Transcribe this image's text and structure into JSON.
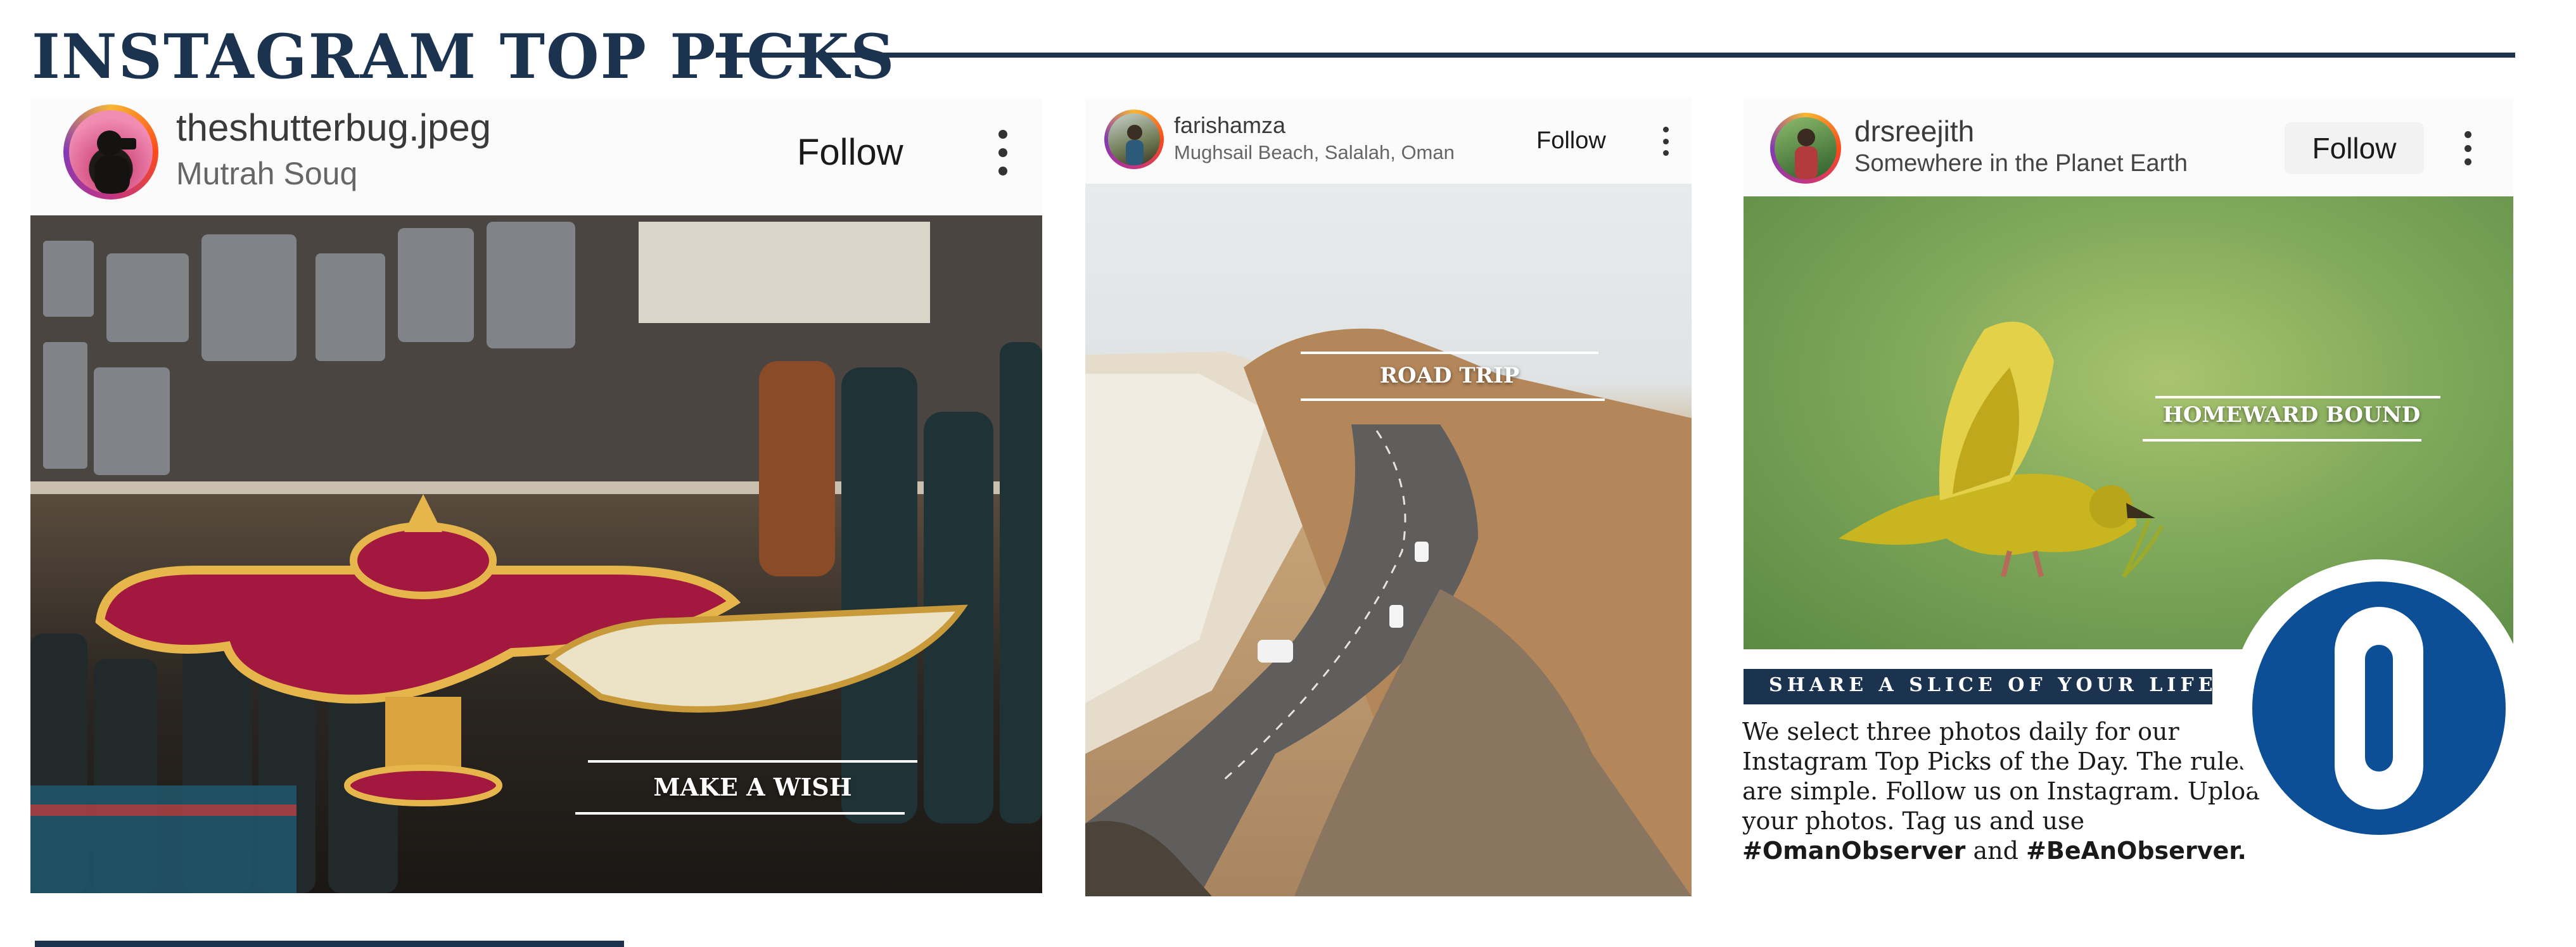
{
  "section": {
    "title": "INSTAGRAM TOP PICKS"
  },
  "posts": [
    {
      "username": "theshutterbug.jpeg",
      "location": "Mutrah Souq",
      "follow_label": "Follow",
      "caption": "MAKE A WISH"
    },
    {
      "username": "farishamza",
      "location": "Mughsail Beach, Salalah, Oman",
      "follow_label": "Follow",
      "caption": "ROAD TRIP"
    },
    {
      "username": "drsreejith",
      "location": "Somewhere in the Planet Earth",
      "follow_label": "Follow",
      "caption": "HOMEWARD BOUND"
    }
  ],
  "share": {
    "banner": "SHARE A SLICE OF YOUR LIFE",
    "body": "We select three photos daily for our Instagram Top Picks of the Day. The rules are simple. Follow us on Instagram. Upload your photos. Tag us and use",
    "hashtag1": "#OmanObserver",
    "conjunction": "and",
    "hashtag2": "#BeAnObserver."
  },
  "logo": {
    "letter": "O"
  },
  "icons": {
    "menu": "more-vertical-icon",
    "avatar": "profile-avatar-icon"
  },
  "colors": {
    "navy": "#1c3350",
    "logo_blue": "#0c4f97",
    "bird_yellow": "#c9b520",
    "sky_green": "#7fa85a"
  }
}
